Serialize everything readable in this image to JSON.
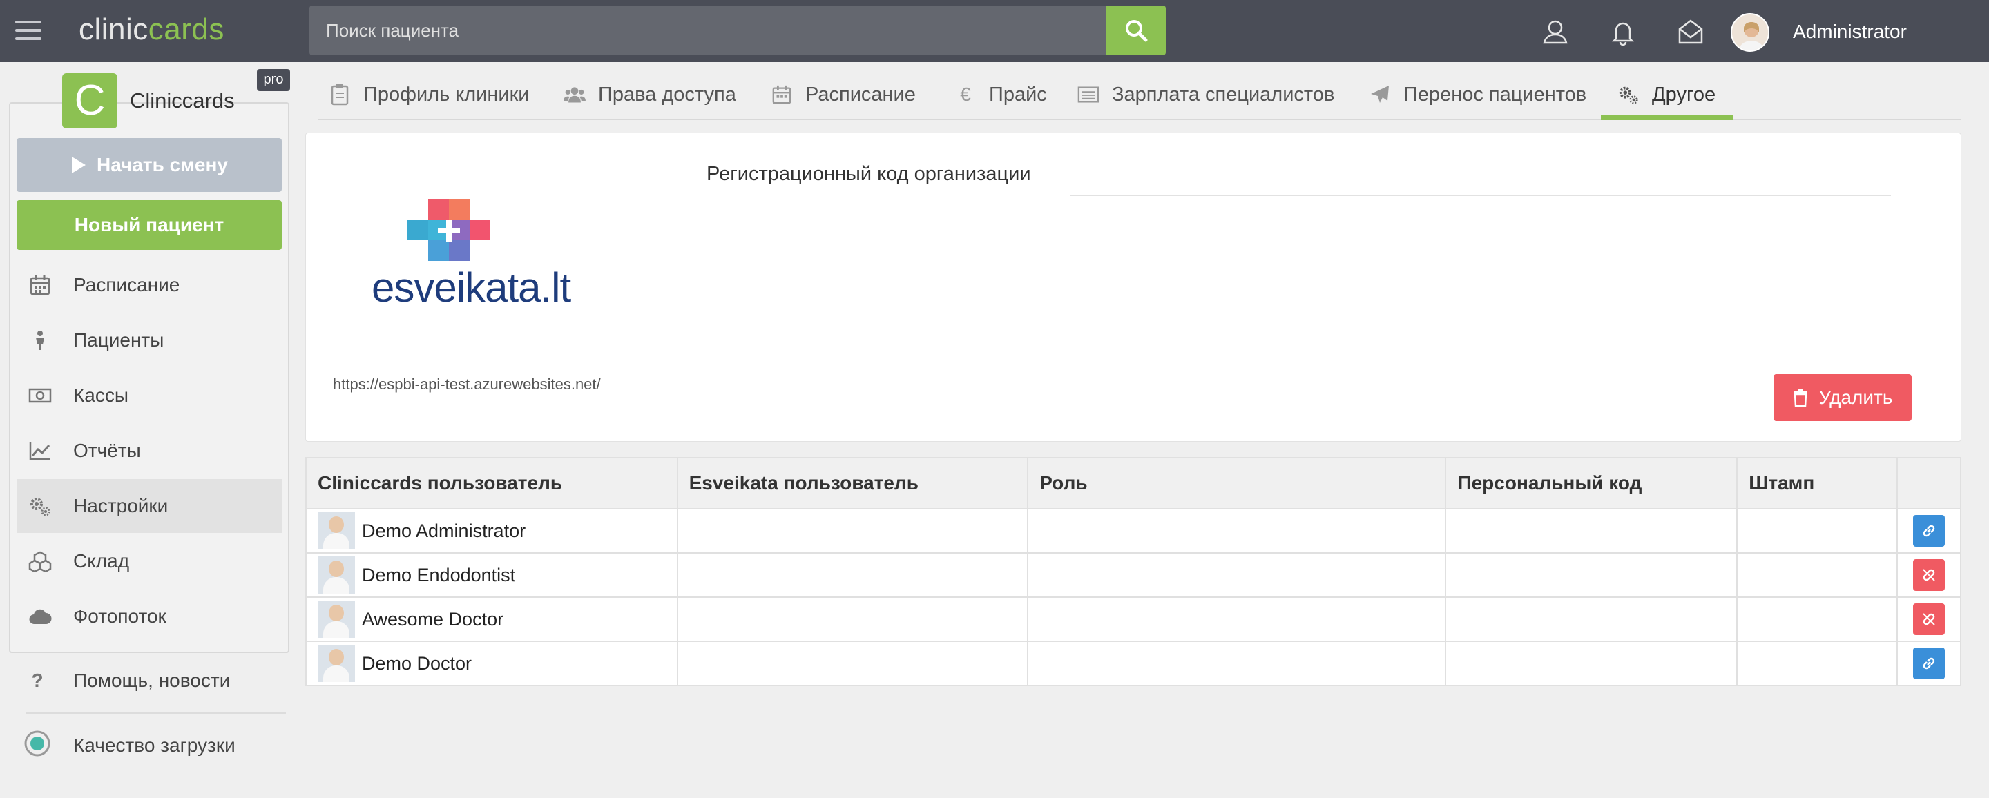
{
  "topbar": {
    "logo_part1": "clinic",
    "logo_part2": "cards",
    "search_placeholder": "Поиск пациента",
    "user_name": "Administrator"
  },
  "sidebar": {
    "brand_letter": "C",
    "brand_name": "Cliniccards",
    "badge": "pro",
    "start_shift_label": "Начать смену",
    "new_patient_label": "Новый пациент",
    "items": [
      {
        "label": "Расписание",
        "icon": "calendar-icon"
      },
      {
        "label": "Пациенты",
        "icon": "person-icon"
      },
      {
        "label": "Кассы",
        "icon": "money-icon"
      },
      {
        "label": "Отчёты",
        "icon": "chart-icon"
      },
      {
        "label": "Настройки",
        "icon": "gears-icon",
        "active": true
      },
      {
        "label": "Склад",
        "icon": "boxes-icon"
      },
      {
        "label": "Фотопоток",
        "icon": "cloud-icon"
      }
    ],
    "help_label": "Помощь, новости",
    "quality_label": "Качество загрузки"
  },
  "tabs": [
    {
      "label": "Профиль клиники",
      "icon": "clipboard-icon"
    },
    {
      "label": "Права доступа",
      "icon": "users-icon"
    },
    {
      "label": "Расписание",
      "icon": "calendar-icon"
    },
    {
      "label": "Прайс",
      "icon": "euro-icon"
    },
    {
      "label": "Зарплата специалистов",
      "icon": "list-icon"
    },
    {
      "label": "Перенос пациентов",
      "icon": "plane-icon"
    },
    {
      "label": "Другое",
      "icon": "gears-icon",
      "active": true
    }
  ],
  "integration": {
    "reg_code_label": "Регистрационный код организации",
    "reg_code_value": "",
    "logo_text": "esveikata.lt",
    "url": "https://espbi-api-test.azurewebsites.net/",
    "delete_label": "Удалить"
  },
  "table": {
    "headers": [
      "Cliniccards пользователь",
      "Esveikata пользователь",
      "Роль",
      "Персональный код",
      "Штамп",
      ""
    ],
    "rows": [
      {
        "user": "Demo Administrator",
        "esveikata_user": "",
        "role": "",
        "personal_code": "",
        "stamp": "",
        "action": "link",
        "action_color": "#3a8fd9"
      },
      {
        "user": "Demo Endodontist",
        "esveikata_user": "",
        "role": "",
        "personal_code": "",
        "stamp": "",
        "action": "unlink",
        "action_color": "#f05a62"
      },
      {
        "user": "Awesome Doctor",
        "esveikata_user": "",
        "role": "",
        "personal_code": "",
        "stamp": "",
        "action": "unlink",
        "action_color": "#f05a62"
      },
      {
        "user": "Demo Doctor",
        "esveikata_user": "",
        "role": "",
        "personal_code": "",
        "stamp": "",
        "action": "link",
        "action_color": "#3a8fd9"
      }
    ]
  },
  "colors": {
    "topbar_bg": "#4a4d57",
    "accent_green": "#8cc152",
    "danger_red": "#f05a62",
    "link_blue": "#3a8fd9",
    "esveikata_blue": "#1e3c7c"
  }
}
